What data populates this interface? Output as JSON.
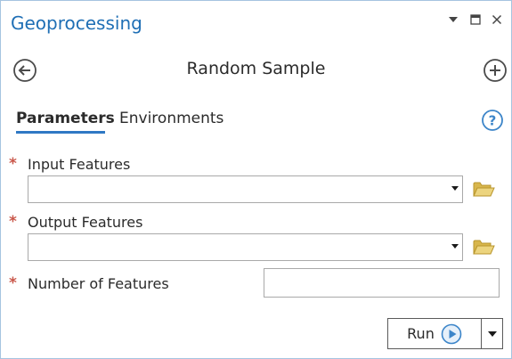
{
  "pane": {
    "title": "Geoprocessing",
    "controls": {
      "menu_icon": "chevron-down-icon",
      "maximize_icon": "maximize-icon",
      "close_icon": "close-icon"
    }
  },
  "tool": {
    "title": "Random Sample",
    "back_icon": "back-arrow-icon",
    "add_icon": "add-circle-icon"
  },
  "tabs": [
    {
      "label": "Parameters",
      "active": true
    },
    {
      "label": "Environments",
      "active": false
    }
  ],
  "help_icon": "help-icon",
  "parameters": [
    {
      "label": "Input Features",
      "required": true,
      "type": "combo",
      "value": "",
      "browse_icon": "folder-icon"
    },
    {
      "label": "Output Features",
      "required": true,
      "type": "combo",
      "value": "",
      "browse_icon": "folder-icon"
    },
    {
      "label": "Number of Features",
      "required": true,
      "type": "text",
      "value": ""
    }
  ],
  "required_marker": "*",
  "run": {
    "label": "Run",
    "icon": "play-icon",
    "dropdown_icon": "dropdown-arrow-icon"
  },
  "colors": {
    "title_blue": "#1f6fb5",
    "tab_underline": "#2f78c4",
    "required_star": "#c9574a",
    "folder": "#e2c465",
    "play_circle": "#3c85c9"
  }
}
